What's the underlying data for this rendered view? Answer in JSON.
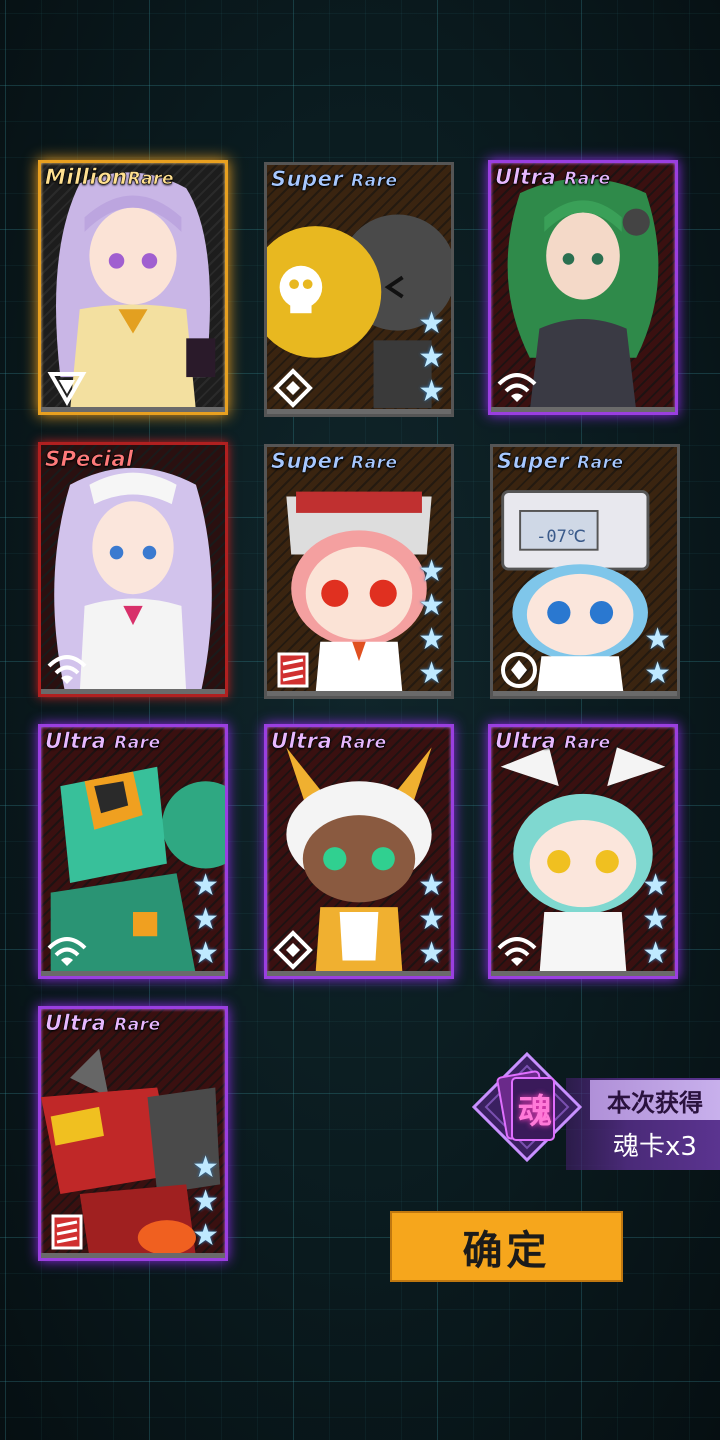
{
  "cards": [
    {
      "rarity_word": "Million",
      "rarity_suffix": "Rare",
      "tier": "mr",
      "stars": 0,
      "class_icon": "triangle-class-icon"
    },
    {
      "rarity_word": "Super",
      "rarity_suffix": "Rare",
      "tier": "sr",
      "stars": 3,
      "class_icon": "diamond-class-icon"
    },
    {
      "rarity_word": "Ultra",
      "rarity_suffix": "Rare",
      "tier": "ur",
      "stars": 0,
      "class_icon": "signal-class-icon"
    },
    {
      "rarity_word": "SPecial",
      "rarity_suffix": "",
      "tier": "sp",
      "stars": 0,
      "class_icon": "signal-class-icon"
    },
    {
      "rarity_word": "Super",
      "rarity_suffix": "Rare",
      "tier": "sr",
      "stars": 4,
      "class_icon": "slash-class-icon"
    },
    {
      "rarity_word": "Super",
      "rarity_suffix": "Rare",
      "tier": "sr",
      "stars": 2,
      "class_icon": "circle-class-icon"
    },
    {
      "rarity_word": "Ultra",
      "rarity_suffix": "Rare",
      "tier": "ur",
      "stars": 3,
      "class_icon": "signal-class-icon"
    },
    {
      "rarity_word": "Ultra",
      "rarity_suffix": "Rare",
      "tier": "ur",
      "stars": 3,
      "class_icon": "diamond-class-icon"
    },
    {
      "rarity_word": "Ultra",
      "rarity_suffix": "Rare",
      "tier": "ur",
      "stars": 3,
      "class_icon": "signal-class-icon"
    },
    {
      "rarity_word": "Ultra",
      "rarity_suffix": "Rare",
      "tier": "ur",
      "stars": 3,
      "class_icon": "slash-class-icon"
    }
  ],
  "fridge_display": "-07℃",
  "reward": {
    "soul_glyph": "魂",
    "title": "本次获得",
    "amount": "魂卡x3"
  },
  "confirm_label": "确定",
  "colors": {
    "confirm": "#f6a61c",
    "ultra_glow": "#8a2be2",
    "million_glow": "#f0a020",
    "special_glow": "#c02020",
    "star": "#bfe9ff",
    "reward_panel": "#5b3490"
  }
}
